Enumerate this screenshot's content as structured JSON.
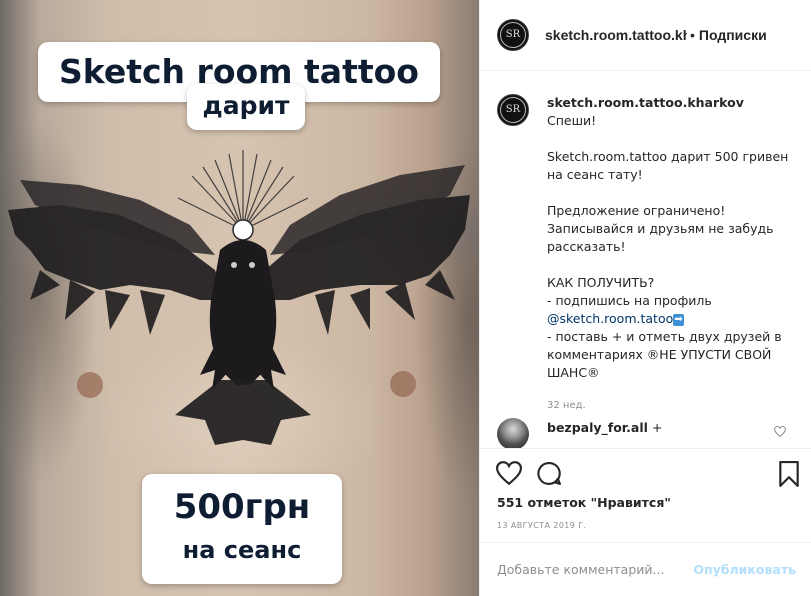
{
  "image": {
    "title_line1": "Sketch room tattoo",
    "title_line2": "дарит",
    "price_line1": "500грн",
    "price_line2": "на сеанс"
  },
  "header": {
    "username": "sketch.room.tattoo.kharkov",
    "separator": "•",
    "follow_label": "Подписки",
    "avatar_letters": "SR"
  },
  "caption": {
    "username": "sketch.room.tattoo.kharkov",
    "first_word": "Спеши!",
    "p1": "Sketch.room.tattoo дарит 500 гривен на сеанс тату!",
    "p2": "Предложение ограничено! Записывайся и друзьям не забудь рассказать!",
    "p3_l1": "КАК ПОЛУЧИТЬ?",
    "p3_l2": "- подпишись на профиль",
    "p3_link": "@sketch.room.tatoo",
    "p3_arrow": "➡",
    "p3_l3": "- поставь + и отметь двух друзей в комментариях ®НЕ УПУСТИ СВОЙ ШАНС®",
    "time_ago": "32 нед."
  },
  "comment": {
    "username": "bezpaly_for.all",
    "text": "+"
  },
  "actions": {
    "likes": "551 отметок \"Нравится\"",
    "date": "13 АВГУСТА 2019 Г."
  },
  "add_comment": {
    "placeholder": "Добавьте комментарий...",
    "post_label": "Опубликовать"
  },
  "icons": {
    "like": "heart-icon",
    "comment": "comment-icon",
    "save": "bookmark-icon",
    "comment_like": "small-heart-icon"
  }
}
